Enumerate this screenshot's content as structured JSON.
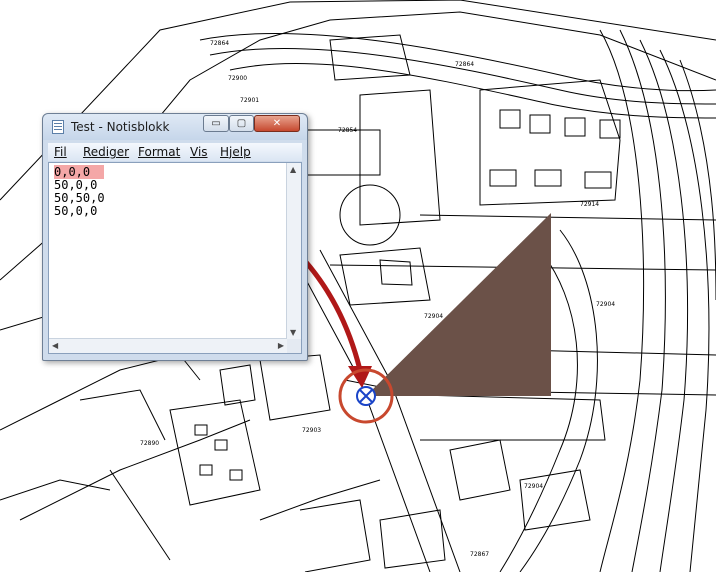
{
  "window": {
    "title": "Test - Notisblokk",
    "buttons": {
      "minimize": "▭",
      "maximize": "▢",
      "close": "✕"
    }
  },
  "menu": [
    {
      "label": "Fil"
    },
    {
      "label": "Rediger"
    },
    {
      "label": "Format"
    },
    {
      "label": "Vis"
    },
    {
      "label": "Hjelp"
    }
  ],
  "editor": {
    "lines": [
      "0,0,0",
      "50,0,0",
      "50,50,0",
      "50,0,0"
    ],
    "highlight_color": "#f4a7a7"
  },
  "scrollbar_icons": {
    "up": "chevron-up-icon",
    "down": "chevron-down-icon",
    "left": "chevron-left-icon",
    "right": "chevron-right-icon"
  },
  "annotation": {
    "arrow_color": "#b01818",
    "circle_color": "#c8482e",
    "marker_color": "#1a44c8"
  },
  "triangle": {
    "fill": "#6b5148"
  },
  "map_labels": [
    "72864",
    "72914",
    "72900",
    "72904",
    "72901",
    "72854",
    "72867",
    "72904",
    "72903",
    "72890",
    "72904"
  ]
}
